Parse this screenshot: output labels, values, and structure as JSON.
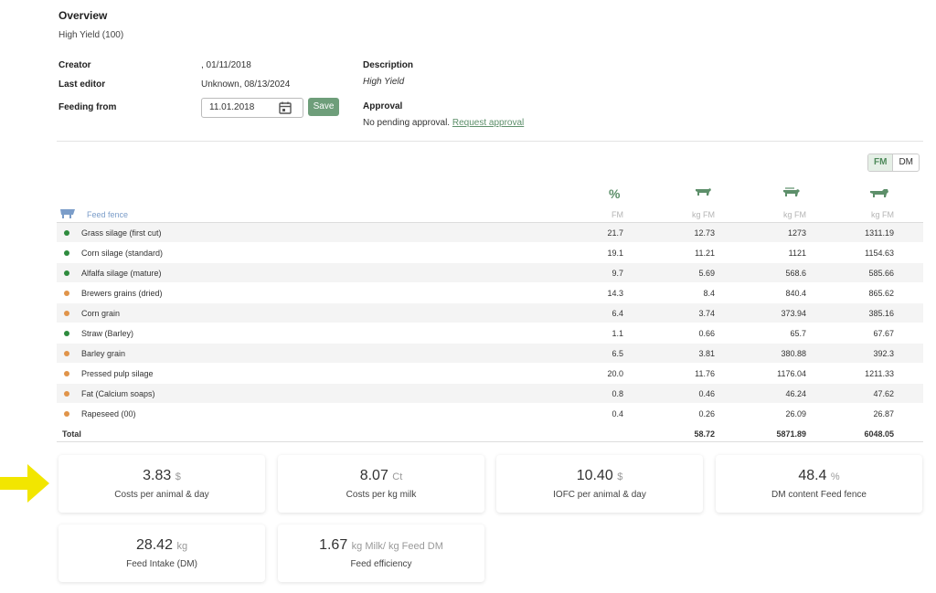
{
  "overview": {
    "title": "Overview",
    "subtitle": "High Yield (100)"
  },
  "meta": {
    "creator_label": "Creator",
    "creator_value": ", 01/11/2018",
    "last_editor_label": "Last editor",
    "last_editor_value": "Unknown, 08/13/2024",
    "feeding_from_label": "Feeding from",
    "feeding_from_value": "11.01.2018",
    "save_label": "Save",
    "description_label": "Description",
    "description_value": "High Yield",
    "approval_label": "Approval",
    "approval_text": "No pending approval.",
    "approval_link": "Request approval"
  },
  "toggle": {
    "fm": "FM",
    "dm": "DM",
    "active": "FM"
  },
  "table": {
    "feed_fence_label": "Feed fence",
    "header_percent": "%",
    "units": [
      "FM",
      "kg FM",
      "kg FM",
      "kg FM"
    ],
    "header_icons": [
      "percent",
      "cow-icon",
      "herd-icon",
      "truck-icon"
    ],
    "rows": [
      {
        "name": "Grass silage (first cut)",
        "dot": "#2e8b3e",
        "c1": "21.7",
        "c2": "12.73",
        "c3": "1273",
        "c4": "1311.19"
      },
      {
        "name": "Corn silage (standard)",
        "dot": "#2e8b3e",
        "c1": "19.1",
        "c2": "11.21",
        "c3": "1121",
        "c4": "1154.63"
      },
      {
        "name": "Alfalfa silage (mature)",
        "dot": "#2e8b3e",
        "c1": "9.7",
        "c2": "5.69",
        "c3": "568.6",
        "c4": "585.66"
      },
      {
        "name": "Brewers grains (dried)",
        "dot": "#e0944a",
        "c1": "14.3",
        "c2": "8.4",
        "c3": "840.4",
        "c4": "865.62"
      },
      {
        "name": "Corn grain",
        "dot": "#e0944a",
        "c1": "6.4",
        "c2": "3.74",
        "c3": "373.94",
        "c4": "385.16"
      },
      {
        "name": "Straw (Barley)",
        "dot": "#2e8b3e",
        "c1": "1.1",
        "c2": "0.66",
        "c3": "65.7",
        "c4": "67.67"
      },
      {
        "name": "Barley grain",
        "dot": "#e0944a",
        "c1": "6.5",
        "c2": "3.81",
        "c3": "380.88",
        "c4": "392.3"
      },
      {
        "name": "Pressed pulp silage",
        "dot": "#e0944a",
        "c1": "20.0",
        "c2": "11.76",
        "c3": "1176.04",
        "c4": "1211.33"
      },
      {
        "name": "Fat (Calcium soaps)",
        "dot": "#e0944a",
        "c1": "0.8",
        "c2": "0.46",
        "c3": "46.24",
        "c4": "47.62"
      },
      {
        "name": "Rapeseed (00)",
        "dot": "#e0944a",
        "c1": "0.4",
        "c2": "0.26",
        "c3": "26.09",
        "c4": "26.87"
      }
    ],
    "total": {
      "name": "Total",
      "c2": "58.72",
      "c3": "5871.89",
      "c4": "6048.05"
    }
  },
  "cards": [
    {
      "value": "3.83",
      "unit": "$",
      "label": "Costs per animal & day"
    },
    {
      "value": "8.07",
      "unit": "Ct",
      "label": "Costs per kg milk"
    },
    {
      "value": "10.40",
      "unit": "$",
      "label": "IOFC per animal & day"
    },
    {
      "value": "48.4",
      "unit": "%",
      "label": "DM content Feed fence"
    },
    {
      "value": "28.42",
      "unit": "kg",
      "label": "Feed Intake (DM)"
    },
    {
      "value": "1.67",
      "unit": "kg Milk/ kg Feed DM",
      "label": "Feed efficiency"
    }
  ],
  "colors": {
    "accent_green": "#6e9e7a",
    "roughage_dot": "#2e8b3e",
    "concentrate_dot": "#e0944a",
    "highlight_arrow": "#f2e600"
  }
}
